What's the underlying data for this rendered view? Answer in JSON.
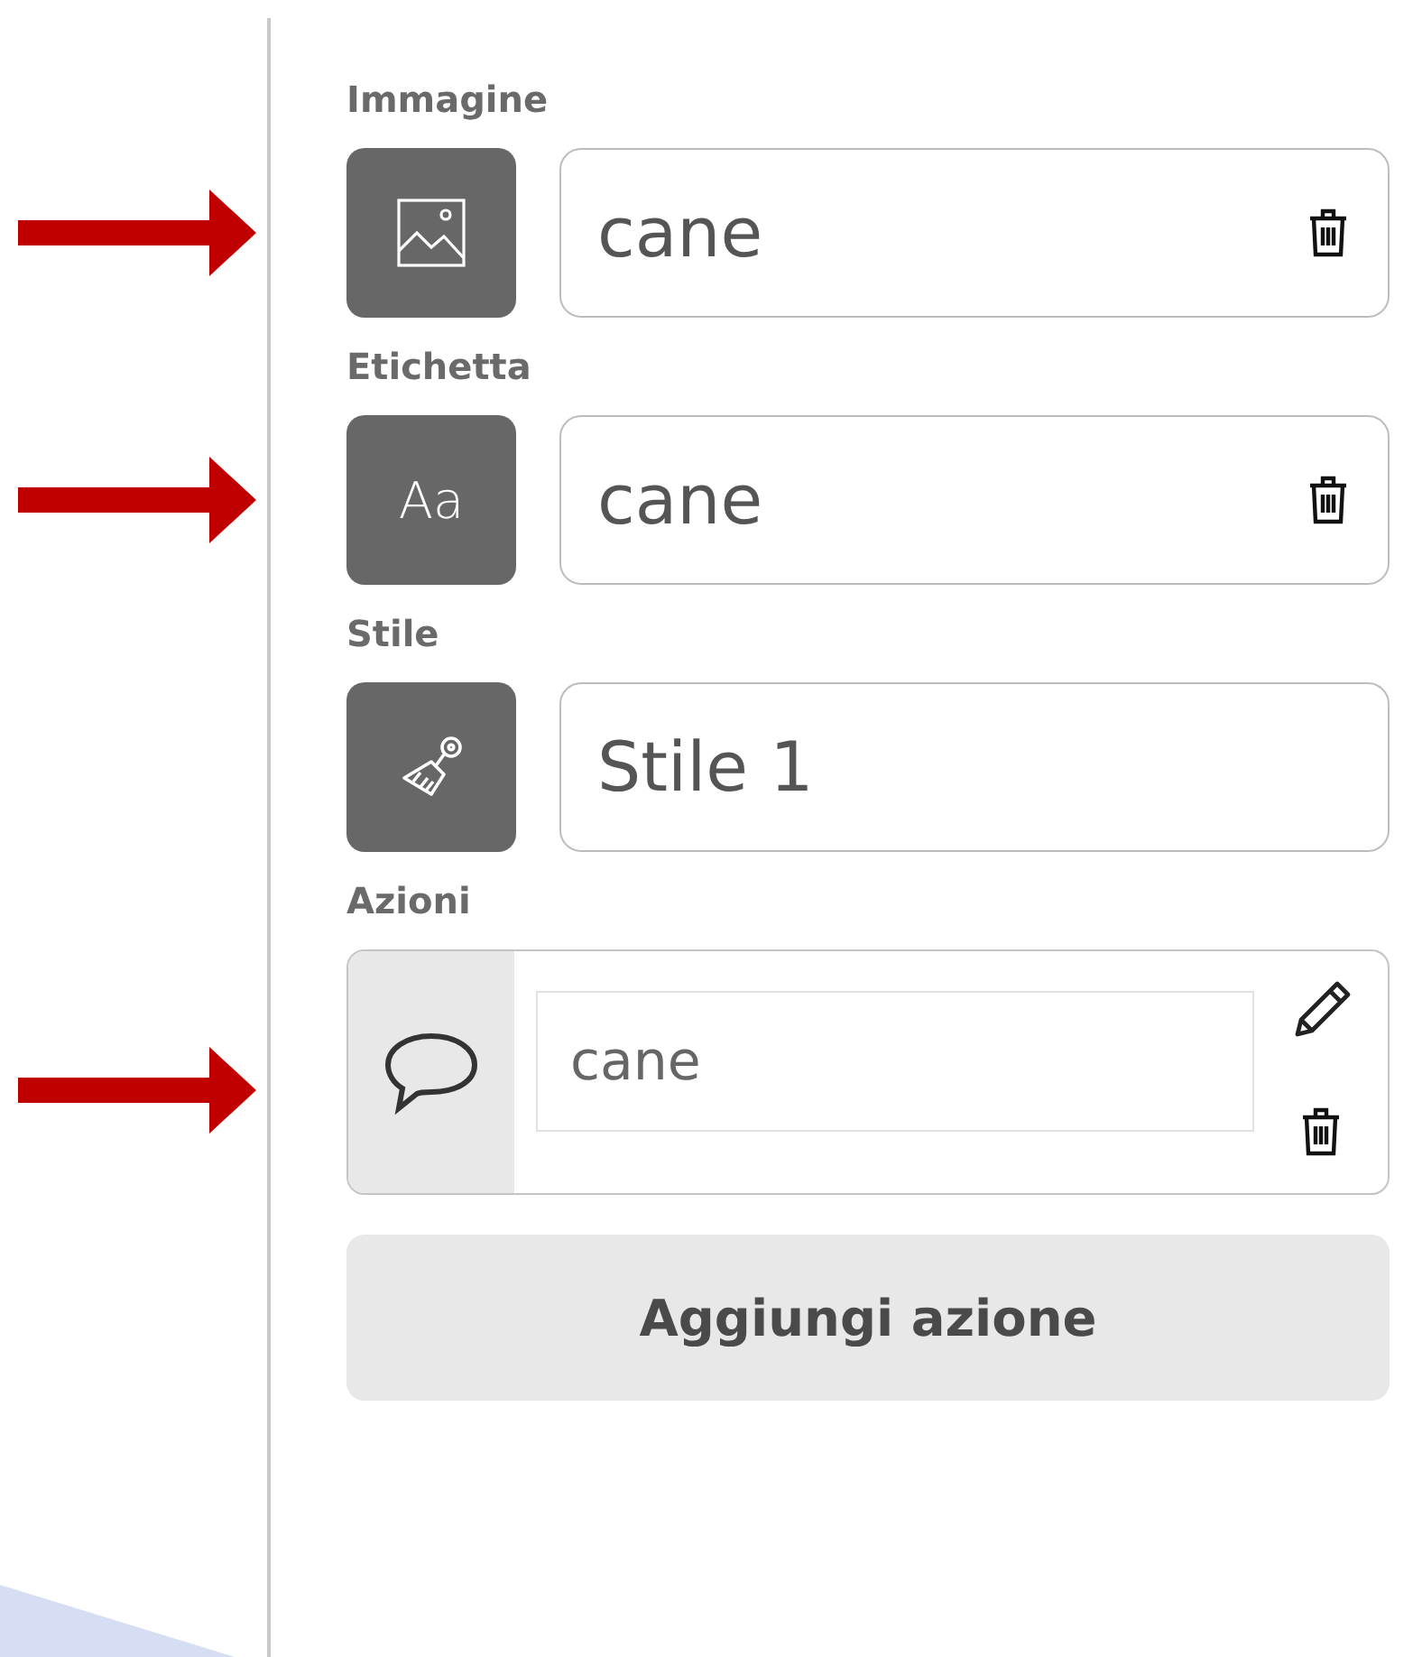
{
  "fields": [
    {
      "kind": "image",
      "label": "Immagine",
      "value": "cane",
      "deletable": true,
      "arrow": true
    },
    {
      "kind": "text",
      "label": "Etichetta",
      "icon_label": "Aa",
      "value": "cane",
      "deletable": true,
      "arrow": true
    },
    {
      "kind": "style",
      "label": "Stile",
      "value": "Stile 1",
      "deletable": false,
      "arrow": false
    }
  ],
  "actions": {
    "label": "Azioni",
    "arrow": true,
    "items": [
      {
        "kind": "speech",
        "value": "cane"
      }
    ]
  },
  "add_button": "Aggiungi azione"
}
